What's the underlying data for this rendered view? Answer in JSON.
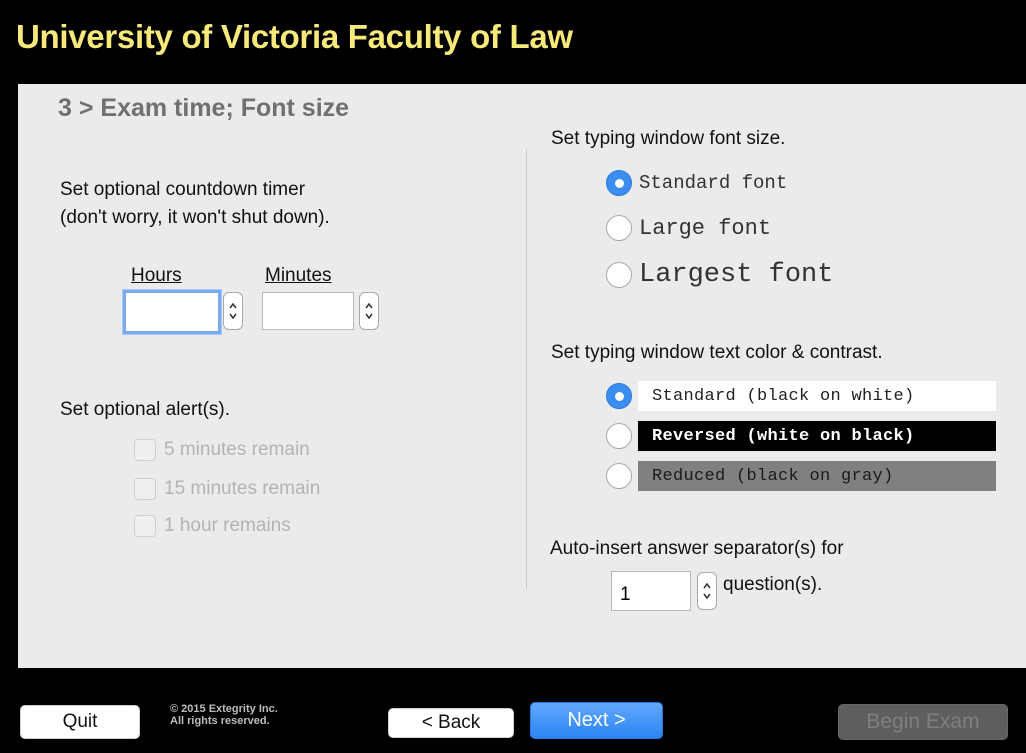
{
  "header": {
    "title": "University of Victoria Faculty of Law"
  },
  "step": {
    "title": "3 > Exam time; Font size"
  },
  "timer": {
    "prompt_line1": "Set optional countdown timer",
    "prompt_line2": "(don't worry, it won't shut down).",
    "hours_label": "Hours",
    "minutes_label": "Minutes",
    "hours_value": "",
    "minutes_value": ""
  },
  "alerts": {
    "prompt": "Set optional alert(s).",
    "options": [
      {
        "label": "5 minutes remain",
        "checked": false,
        "enabled": false
      },
      {
        "label": "15 minutes remain",
        "checked": false,
        "enabled": false
      },
      {
        "label": "1 hour remains",
        "checked": false,
        "enabled": false
      }
    ]
  },
  "font_size": {
    "prompt": "Set typing window font size.",
    "options": [
      {
        "label": "Standard font",
        "selected": true
      },
      {
        "label": "Large font",
        "selected": false
      },
      {
        "label": "Largest font",
        "selected": false
      }
    ]
  },
  "contrast": {
    "prompt": "Set typing window text color & contrast.",
    "options": [
      {
        "label": "Standard (black on white)",
        "selected": true,
        "bg": "#ffffff",
        "fg": "#222222"
      },
      {
        "label": "Reversed (white on black)",
        "selected": false,
        "bg": "#000000",
        "fg": "#ffffff"
      },
      {
        "label": "Reduced (black on gray)",
        "selected": false,
        "bg": "#808080",
        "fg": "#1a1a1a"
      }
    ]
  },
  "separator": {
    "prompt": "Auto-insert answer separator(s) for",
    "value": "1",
    "suffix": "question(s)."
  },
  "footer": {
    "quit_label": "Quit",
    "copyright_line1": "© 2015 Extegrity Inc.",
    "copyright_line2": "All rights reserved.",
    "back_label": "< Back",
    "next_label": "Next >",
    "begin_label": "Begin Exam"
  },
  "colors": {
    "title": "#f7e97a",
    "panel": "#ebebeb",
    "accent": "#3b8ef0"
  }
}
